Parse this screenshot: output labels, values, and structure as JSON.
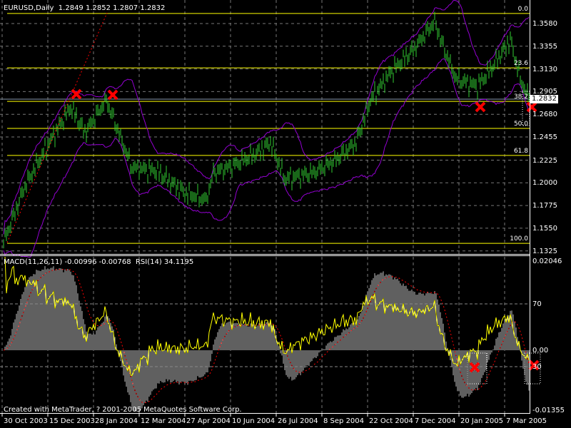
{
  "header": {
    "symbol": "EURUSD,Daily",
    "open": "1.2849",
    "high": "1.2852",
    "low": "1.2807",
    "close": "1.2832"
  },
  "indicator_header": {
    "macd": "MACD(11,26,11) -0.00996 -0.00768",
    "rsi": "RSI(14) 34.1195"
  },
  "footer": "Created with MetaTrader, ? 2001-2005 MetaQuotes Software Corp.",
  "current_price": "1.2832",
  "price_axis": [
    "1.3580",
    "1.3355",
    "1.3130",
    "1.2905",
    "1.2680",
    "1.2455",
    "1.2225",
    "1.2000",
    "1.1775",
    "1.1550",
    "1.1325"
  ],
  "indicator_axis": {
    "top": "0.02046",
    "zero": "0.00",
    "bottom": "-0.01355",
    "rsi70": "70",
    "rsi30": "30"
  },
  "fib_levels": [
    {
      "label": "0.0",
      "price": 1.368
    },
    {
      "label": "23.6",
      "price": 1.314
    },
    {
      "label": "38.2",
      "price": 1.2808
    },
    {
      "label": "50.0",
      "price": 1.254
    },
    {
      "label": "61.8",
      "price": 1.2272
    },
    {
      "label": "100.0",
      "price": 1.14
    }
  ],
  "date_axis": [
    "30 Oct 2003",
    "15 Dec 2003",
    "28 Jan 2004",
    "12 Mar 2004",
    "27 Apr 2004",
    "10 Jun 2004",
    "26 Jul 2004",
    "8 Sep 2004",
    "22 Oct 2004",
    "7 Dec 2004",
    "20 Jan 2005",
    "7 Mar 2005"
  ],
  "colors": {
    "bars": "#32cd32",
    "bands": "#9400d3",
    "fib": "#ffff00",
    "trend": "#ff0000",
    "rsi": "#ffff00",
    "macd_hist": "#c0c0c0",
    "signal": "#ff0000"
  },
  "chart_data": {
    "type": "line",
    "title": "EURUSD,Daily",
    "ylim": [
      1.1325,
      1.358
    ],
    "close_points": [
      [
        0,
        1.141
      ],
      [
        15,
        1.197
      ],
      [
        32,
        1.24
      ],
      [
        47,
        1.275
      ],
      [
        57,
        1.25
      ],
      [
        72,
        1.282
      ],
      [
        82,
        1.245
      ],
      [
        90,
        1.215
      ],
      [
        107,
        1.212
      ],
      [
        127,
        1.19
      ],
      [
        142,
        1.183
      ],
      [
        147,
        1.21
      ],
      [
        162,
        1.218
      ],
      [
        177,
        1.229
      ],
      [
        187,
        1.24
      ],
      [
        197,
        1.204
      ],
      [
        217,
        1.21
      ],
      [
        232,
        1.222
      ],
      [
        247,
        1.24
      ],
      [
        257,
        1.282
      ],
      [
        272,
        1.311
      ],
      [
        287,
        1.332
      ],
      [
        302,
        1.36
      ],
      [
        307,
        1.339
      ],
      [
        317,
        1.303
      ],
      [
        332,
        1.296
      ],
      [
        342,
        1.314
      ],
      [
        355,
        1.342
      ],
      [
        362,
        1.303
      ],
      [
        368,
        1.2832
      ]
    ]
  }
}
